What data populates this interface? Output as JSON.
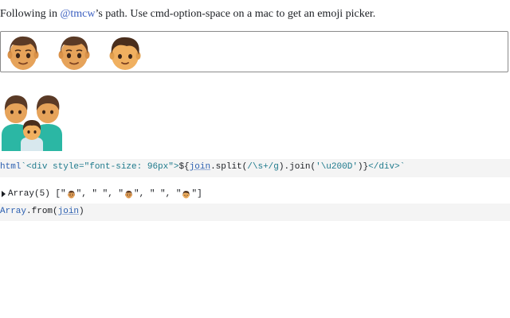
{
  "intro": {
    "prefix": "Following in ",
    "link_text": "@tmcw",
    "suffix": "’s path. Use cmd-option-space on a mac to get an emoji picker."
  },
  "emoji_input": {
    "emojis": [
      "man-emoji",
      "man-emoji",
      "boy-emoji"
    ]
  },
  "family_emoji": "family-man-man-boy-emoji",
  "cell_1": {
    "tag": "html",
    "tick": "`",
    "open_tag": "<div style=\"font-size: 96px\">",
    "interp_open": "${",
    "var": "join",
    "method_split": ".split(",
    "regex": "/\\s+/g",
    "method_join": ").join(",
    "zwj": "'\\u200D'",
    "interp_close": ")}",
    "close_tag": "</div>",
    "tick_end": "`"
  },
  "output": {
    "label": "Array(5) [",
    "items": [
      "\"",
      "\", \" \", \"",
      "\", \" \", \"",
      "\"]"
    ]
  },
  "cell_2": {
    "obj": "Array",
    "method": ".from(",
    "var": "join",
    "close": ")"
  },
  "colors": {
    "link": "#3b5fc0",
    "code_keyword": "#2b5fb0",
    "code_string": "#1e7a8c",
    "cell_bg": "#f4f4f4"
  }
}
